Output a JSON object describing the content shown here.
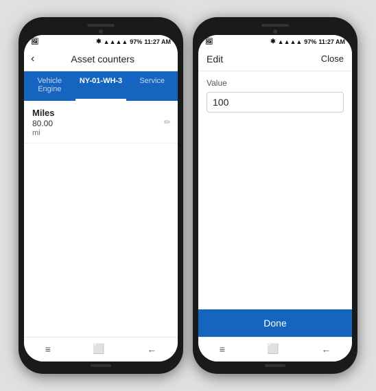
{
  "phone1": {
    "status": {
      "left": "📷",
      "battery": "97%",
      "time": "11:27 AM",
      "signal": "▲▲▲▲"
    },
    "header": {
      "back_label": "‹",
      "title": "Asset counters"
    },
    "tabs": [
      {
        "label": "Vehicle Engine",
        "active": false
      },
      {
        "label": "NY-01-WH-3",
        "active": true
      },
      {
        "label": "Service",
        "active": false
      }
    ],
    "counter": {
      "label": "Miles",
      "value": "80.00",
      "unit": "mi"
    },
    "nav": {
      "menu_icon": "≡",
      "recent_icon": "⬜",
      "back_icon": "←"
    }
  },
  "phone2": {
    "status": {
      "left": "📷",
      "battery": "97%",
      "time": "11:27 AM",
      "signal": "▲▲▲▲"
    },
    "edit_bar": {
      "edit_label": "Edit",
      "close_label": "Close"
    },
    "value_label": "Value",
    "value_input": "100",
    "done_label": "Done",
    "nav": {
      "menu_icon": "≡",
      "recent_icon": "⬜",
      "back_icon": "←"
    }
  }
}
